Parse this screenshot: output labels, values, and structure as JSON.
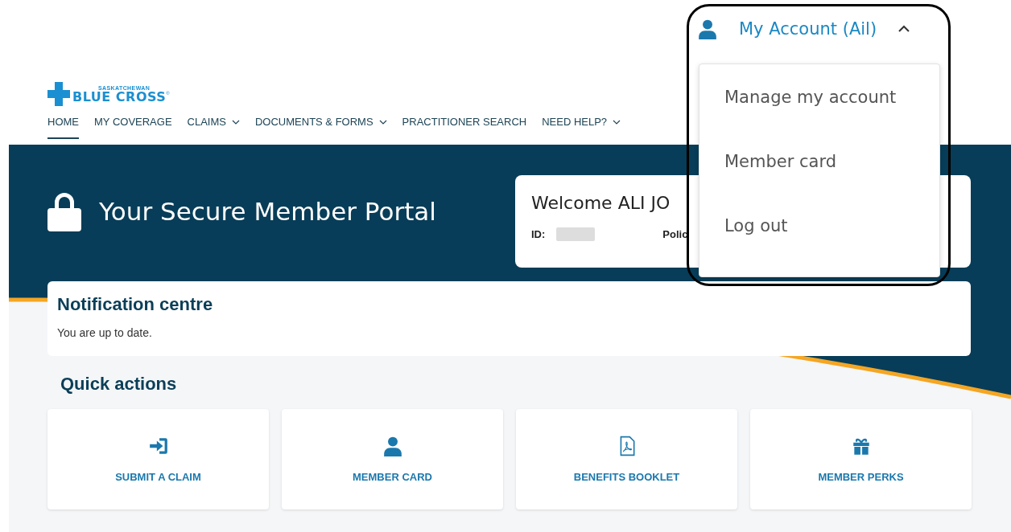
{
  "header": {
    "logo": {
      "region": "SASKATCHEWAN",
      "name": "BLUE CROSS",
      "mark": "®"
    },
    "nav": [
      {
        "label": "HOME",
        "selected": true,
        "has_menu": false
      },
      {
        "label": "MY COVERAGE",
        "selected": false,
        "has_menu": false
      },
      {
        "label": "CLAIMS",
        "selected": false,
        "has_menu": true
      },
      {
        "label": "DOCUMENTS & FORMS",
        "selected": false,
        "has_menu": true
      },
      {
        "label": "PRACTITIONER SEARCH",
        "selected": false,
        "has_menu": false
      },
      {
        "label": "NEED HELP?",
        "selected": false,
        "has_menu": true
      }
    ]
  },
  "account_menu": {
    "label": "My Account (Ail)",
    "expanded": true,
    "highlighted": true,
    "items": [
      "Manage my account",
      "Member card",
      "Log out"
    ]
  },
  "hero": {
    "title": "Your Secure Member Portal",
    "welcome": {
      "greeting": "Welcome ALI JO",
      "id_label": "ID:",
      "policy_label": "Polic"
    }
  },
  "notifications": {
    "title": "Notification centre",
    "message": "You are up to date."
  },
  "quick_actions": {
    "title": "Quick actions",
    "items": [
      {
        "label": "SUBMIT A CLAIM",
        "kind": "sign-in"
      },
      {
        "label": "MEMBER CARD",
        "kind": "person"
      },
      {
        "label": "BENEFITS BOOKLET",
        "kind": "pdf"
      },
      {
        "label": "MEMBER PERKS",
        "kind": "gift"
      }
    ]
  }
}
